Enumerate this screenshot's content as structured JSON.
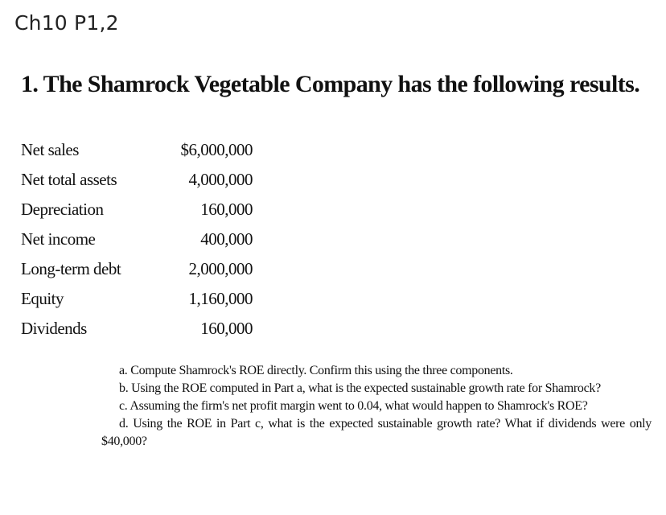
{
  "header": {
    "title": "Ch10 P1,2"
  },
  "problem": {
    "heading": "1. The Shamrock Vegetable Company has the following results.",
    "financials": [
      {
        "label": "Net sales",
        "value": "$6,000,000"
      },
      {
        "label": "Net total assets",
        "value": "4,000,000"
      },
      {
        "label": "Depreciation",
        "value": "160,000"
      },
      {
        "label": "Net income",
        "value": "400,000"
      },
      {
        "label": "Long-term debt",
        "value": "2,000,000"
      },
      {
        "label": "Equity",
        "value": "1,160,000"
      },
      {
        "label": "Dividends",
        "value": "160,000"
      }
    ],
    "questions": [
      "a. Compute Shamrock's ROE directly. Confirm this using the three components.",
      "b. Using the ROE computed in Part a, what is the expected sustainable growth rate for Shamrock?",
      "c. Assuming the firm's net profit margin went to 0.04, what would happen to Shamrock's ROE?",
      "d. Using the ROE in Part c, what is the expected sustainable growth rate? What if dividends were only $40,000?"
    ]
  }
}
